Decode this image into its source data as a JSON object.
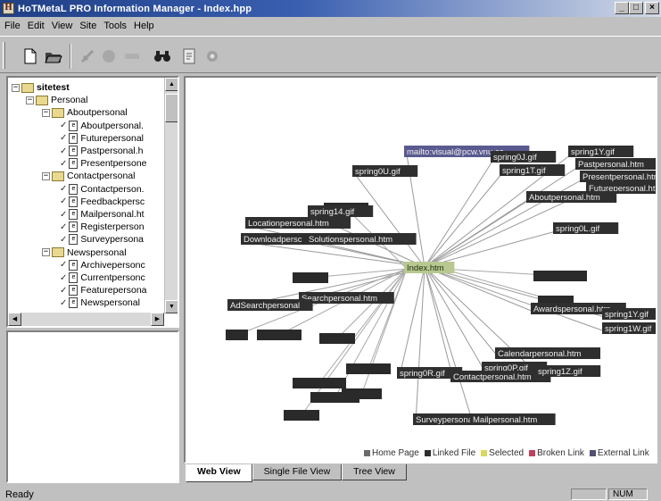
{
  "window": {
    "title": "HoTMetaL PRO  Information Manager - Index.hpp",
    "controls": {
      "minimize": "_",
      "maximize": "□",
      "close": "×"
    }
  },
  "menu": [
    "File",
    "Edit",
    "View",
    "Site",
    "Tools",
    "Help"
  ],
  "toolbar": {
    "icons": [
      "new-document-icon",
      "open-folder-icon",
      "link-icon",
      "stop-icon",
      "refresh-icon",
      "binoculars-icon",
      "document-info-icon",
      "settings-icon"
    ]
  },
  "tree": {
    "rows": [
      {
        "level": 0,
        "type": "root",
        "label": "sitetest"
      },
      {
        "level": 1,
        "type": "folder",
        "label": "Personal"
      },
      {
        "level": 2,
        "type": "folder",
        "label": "Aboutpersonal"
      },
      {
        "level": 3,
        "type": "file",
        "label": "Aboutpersonal."
      },
      {
        "level": 3,
        "type": "file",
        "label": "Futurepersonal"
      },
      {
        "level": 3,
        "type": "file",
        "label": "Pastpersonal.h"
      },
      {
        "level": 3,
        "type": "file",
        "label": "Presentpersone"
      },
      {
        "level": 2,
        "type": "folder",
        "label": "Contactpersonal"
      },
      {
        "level": 3,
        "type": "file",
        "label": "Contactperson."
      },
      {
        "level": 3,
        "type": "file",
        "label": "Feedbackpersc"
      },
      {
        "level": 3,
        "type": "file",
        "label": "Mailpersonal.ht"
      },
      {
        "level": 3,
        "type": "file",
        "label": "Registerperson"
      },
      {
        "level": 3,
        "type": "file",
        "label": "Surveypersona"
      },
      {
        "level": 2,
        "type": "folder",
        "label": "Newspersonal"
      },
      {
        "level": 3,
        "type": "file",
        "label": "Archivepersonc"
      },
      {
        "level": 3,
        "type": "file",
        "label": "Currentpersonc"
      },
      {
        "level": 3,
        "type": "file",
        "label": "Featurepersona"
      },
      {
        "level": 3,
        "type": "file",
        "label": "Newspersonal"
      }
    ]
  },
  "graph": {
    "center": "Index.htm",
    "nodes": [
      {
        "label": "mailto:visual@pcw.vnu.co",
        "kind": "external"
      },
      {
        "label": "spring0U.gif",
        "kind": "linked"
      },
      {
        "label": "spring0J.gif",
        "kind": "linked"
      },
      {
        "label": "spring1T.gif",
        "kind": "linked"
      },
      {
        "label": "spring1Y.gif",
        "kind": "linked"
      },
      {
        "label": "Pastpersonal.htm",
        "kind": "linked"
      },
      {
        "label": "Presentpersonal.htm",
        "kind": "linked"
      },
      {
        "label": "Futurepersonal.htm",
        "kind": "linked"
      },
      {
        "label": "Aboutpersonal.htm",
        "kind": "linked"
      },
      {
        "label": "spring14.gif",
        "kind": "linked"
      },
      {
        "label": "Locationpersonal.htm",
        "kind": "linked"
      },
      {
        "label": "Downloadpersc",
        "kind": "linked"
      },
      {
        "label": "Solutionspersonal.htm",
        "kind": "linked"
      },
      {
        "label": "spring0L.gif",
        "kind": "linked"
      },
      {
        "label": "Searchpersonal.htm",
        "kind": "linked"
      },
      {
        "label": "AdSearchpersonal",
        "kind": "linked"
      },
      {
        "label": "Awardspersonal.htm",
        "kind": "linked"
      },
      {
        "label": "spring1Y.gif",
        "kind": "linked"
      },
      {
        "label": "spring1W.gif",
        "kind": "linked"
      },
      {
        "label": "Calendarpersonal.htm",
        "kind": "linked"
      },
      {
        "label": "spring0P.gif",
        "kind": "linked"
      },
      {
        "label": "spring0R.gif",
        "kind": "linked"
      },
      {
        "label": "Contactpersonal.htm",
        "kind": "linked"
      },
      {
        "label": "spring1Z.gif",
        "kind": "linked"
      },
      {
        "label": "Surveypersonal.htm",
        "kind": "linked"
      },
      {
        "label": "Mailpersonal.htm",
        "kind": "linked"
      }
    ]
  },
  "legend": [
    {
      "label": "Home Page",
      "color": "#6b6b6b"
    },
    {
      "label": "Linked File",
      "color": "#2e2e2e"
    },
    {
      "label": "Selected",
      "color": "#d8d860"
    },
    {
      "label": "Broken Link",
      "color": "#c04060"
    },
    {
      "label": "External Link",
      "color": "#505070"
    }
  ],
  "tabs": [
    "Web View",
    "Single File View",
    "Tree View"
  ],
  "status": {
    "text": "Ready",
    "num": "NUM"
  },
  "colors": {
    "node": "#2f2f2f",
    "center": "#b8c890",
    "external": "#5a5a90"
  }
}
